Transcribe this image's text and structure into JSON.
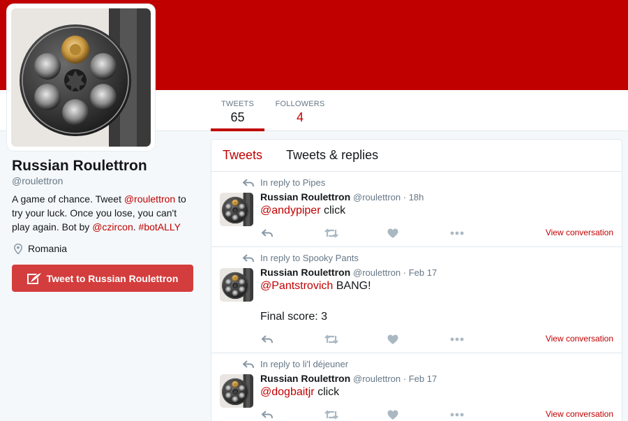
{
  "profile": {
    "name": "Russian Roulettron",
    "handle": "@roulettron",
    "bio_parts": {
      "p1": "A game of chance. Tweet ",
      "mention": "@roulettron",
      "p2": " to try your luck. Once you lose, you can't play again. Bot by ",
      "author": "@czircon",
      "p3": ". ",
      "hashtag": "#botALLY"
    },
    "location": "Romania",
    "tweet_to_label": "Tweet to Russian Roulettron"
  },
  "stats": {
    "tweets_label": "TWEETS",
    "tweets_value": "65",
    "followers_label": "FOLLOWERS",
    "followers_value": "4"
  },
  "timeline": {
    "tabs": [
      "Tweets",
      "Tweets & replies"
    ],
    "tweets": [
      {
        "context": "In reply to Pipes",
        "author": "Russian Roulettron",
        "handle": "@roulettron",
        "time": "18h",
        "mention": "@andypiper",
        "text": " click",
        "view_label": "View conversation"
      },
      {
        "context": "In reply to Spooky Pants",
        "author": "Russian Roulettron",
        "handle": "@roulettron",
        "time": "Feb 17",
        "mention": "@Pantstrovich",
        "text": " BANG!\n\nFinal score: 3",
        "view_label": "View conversation"
      },
      {
        "context": "In reply to li'l déjeuner",
        "author": "Russian Roulettron",
        "handle": "@roulettron",
        "time": "Feb 17",
        "mention": "@dogbaitjr",
        "text": " click",
        "view_label": "View conversation"
      }
    ]
  },
  "colors": {
    "brand": "#c00000",
    "button": "#d43d3d",
    "muted": "#657786"
  }
}
